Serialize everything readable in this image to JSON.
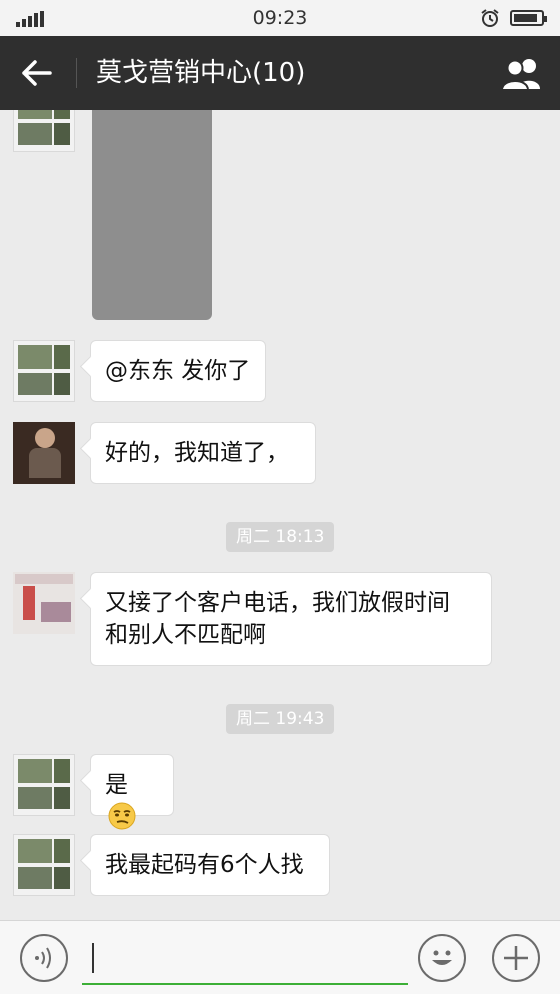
{
  "status_bar": {
    "time": "09:23",
    "battery_level": 0.9
  },
  "header": {
    "title": "莫戈营销中心(10)"
  },
  "messages": [
    {
      "type": "image"
    },
    {
      "type": "text",
      "text": "@东东 发你了"
    },
    {
      "type": "text",
      "text": "好的，我知道了，"
    },
    {
      "type": "timestamp",
      "text": "周二 18:13"
    },
    {
      "type": "text",
      "lines": [
        "又接了个客户电话，我们放假时间",
        "和别人不匹配啊"
      ]
    },
    {
      "type": "timestamp",
      "text": "周二 19:43"
    },
    {
      "type": "text",
      "text": "是",
      "emoji": "smirk-emoji"
    },
    {
      "type": "text",
      "text": "我最起码有6个人找"
    }
  ],
  "input_bar": {
    "value": "",
    "placeholder": ""
  },
  "icons": {
    "back": "back-arrow-icon",
    "group": "group-members-icon",
    "voice": "voice-icon",
    "emoji": "emoji-icon",
    "more": "plus-icon"
  },
  "colors": {
    "title_bar": "#2f2f2f",
    "chat_bg": "#ebebeb",
    "input_accent": "#3caf36"
  }
}
